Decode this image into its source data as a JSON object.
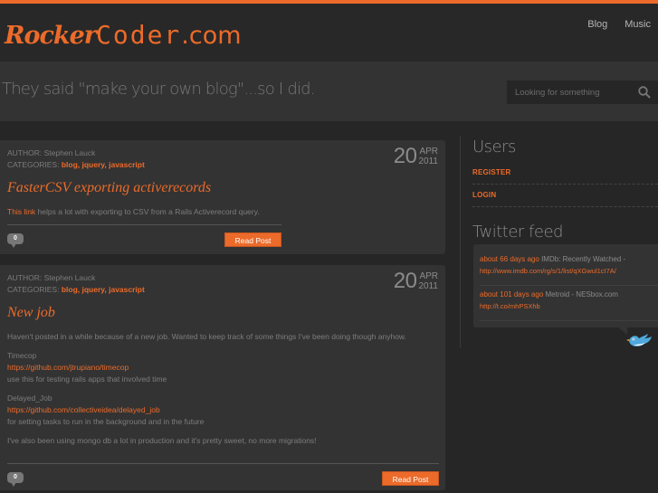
{
  "header": {
    "logo": {
      "part1": "Rocker",
      "part2": "Coder",
      "part3": ".com"
    },
    "nav": [
      {
        "label": "Blog"
      },
      {
        "label": "Music"
      }
    ]
  },
  "tagline": "They said \"make your own blog\"...so I did.",
  "search": {
    "placeholder": "Looking for something",
    "value": "",
    "icon": "search-icon"
  },
  "colors": {
    "accent": "#ec6b2a",
    "background": "#262626",
    "panel": "#333333"
  },
  "posts": [
    {
      "author_label": "AUTHOR:",
      "author": "Stephen Lauck",
      "categories_label": "CATEGORIES:",
      "categories": "blog, jquery, javascript",
      "date": {
        "day": "20",
        "month": "APR",
        "year": "2011"
      },
      "title": "FasterCSV exporting activerecords",
      "body": {
        "link_text": "This link",
        "text": " helps a lot with exporting to CSV from a Rails Activerecord query."
      },
      "comments": "0",
      "read_label": "Read Post"
    },
    {
      "author_label": "AUTHOR:",
      "author": "Stephen Lauck",
      "categories_label": "CATEGORIES:",
      "categories": "blog, jquery, javascript",
      "date": {
        "day": "20",
        "month": "APR",
        "year": "2011"
      },
      "title": "New job",
      "body": {
        "intro": "Haven't posted in a while because of a new job. Wanted to keep track of some things I've been doing though anyhow.",
        "item1_name": "Timecop",
        "item1_url": "https://github.com/jtrupiano/timecop",
        "item1_desc": "use this for testing rails apps that involved time",
        "item2_name": "Delayed_Job",
        "item2_url": "https://github.com/collectiveidea/delayed_job",
        "item2_desc": "for setting tasks to run in the background and in the future",
        "outro": "I've also been using mongo db a lot in production and it's pretty sweet, no more migrations!"
      },
      "comments": "0",
      "read_label": "Read Post"
    }
  ],
  "sidebar": {
    "users_heading": "Users",
    "register_label": "REGISTER",
    "login_label": "LOGIN",
    "twitter_heading": "Twitter feed",
    "tweets": [
      {
        "time": "about 66 days ago",
        "text": " IMDb: Recently Watched -",
        "url": "http://www.imdb.com/rg/s/1/list/qXGwul1cI7A/"
      },
      {
        "time": "about 101 days ago",
        "text": " Metroid - NESbox.com",
        "url": "http://t.co/mhPSXhb"
      }
    ]
  }
}
